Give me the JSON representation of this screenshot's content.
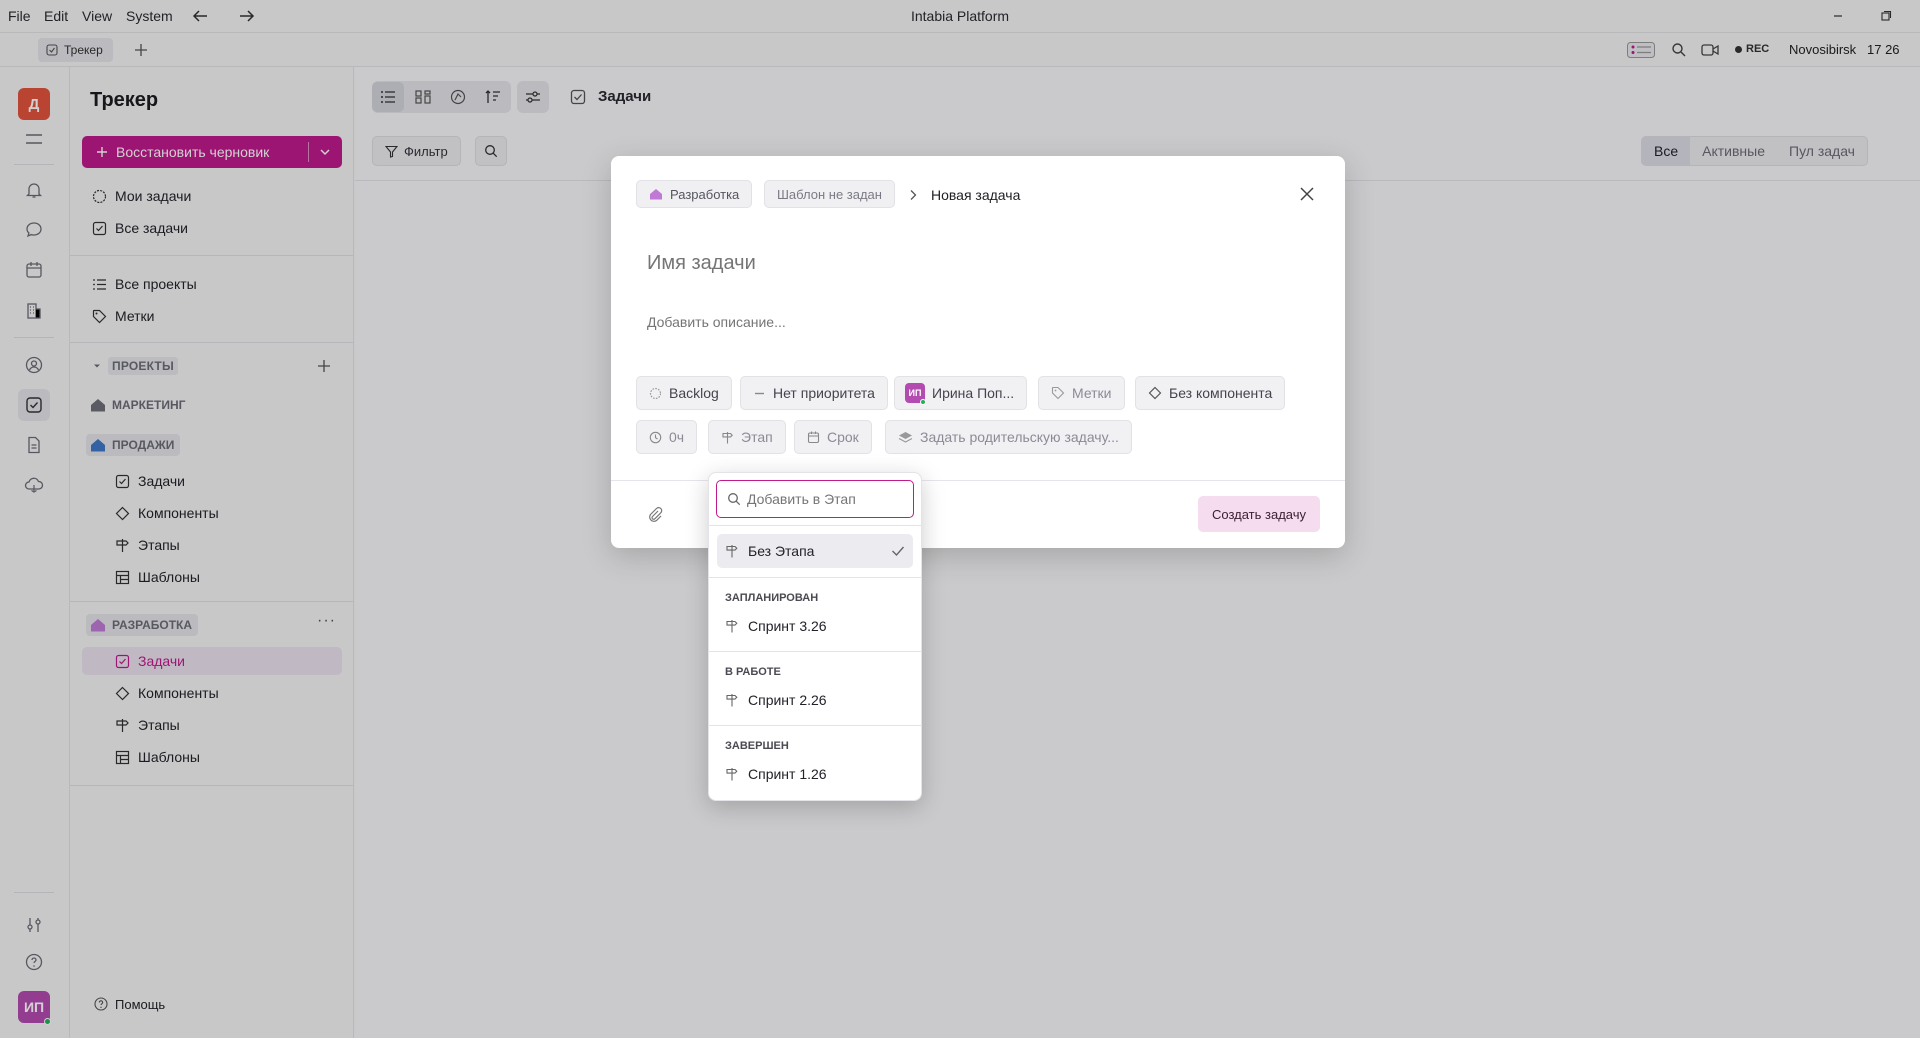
{
  "window": {
    "menu": [
      "File",
      "Edit",
      "View",
      "System"
    ],
    "title": "Intabia Platform"
  },
  "tabs": {
    "active": "Трекер"
  },
  "statusbar": {
    "rec": "REC",
    "location": "Novosibirsk",
    "time": "17 26"
  },
  "rail": {
    "workspace_initial": "Д",
    "user_initials": "ИП"
  },
  "sidebar": {
    "title": "Трекер",
    "restore_draft": "Восстановить черновик",
    "my_tasks": "Мои задачи",
    "all_tasks": "Все задачи",
    "all_projects": "Все проекты",
    "labels": "Метки",
    "projects_header": "ПРОЕКТЫ",
    "projects": [
      {
        "name": "МАРКЕТИНГ"
      },
      {
        "name": "ПРОДАЖИ",
        "items": [
          "Задачи",
          "Компоненты",
          "Этапы",
          "Шаблоны"
        ]
      },
      {
        "name": "РАЗРАБОТКА",
        "items": [
          "Задачи",
          "Компоненты",
          "Этапы",
          "Шаблоны"
        ]
      }
    ],
    "help": "Помощь"
  },
  "main": {
    "header_title": "Задачи",
    "filter": "Фильтр",
    "segments": [
      "Все",
      "Активные",
      "Пул задач"
    ],
    "active_segment": "Все"
  },
  "dialog": {
    "project": "Разработка",
    "template": "Шаблон не задан",
    "crumb_current": "Новая задача",
    "name_placeholder": "Имя задачи",
    "description_placeholder": "Добавить описание...",
    "status": "Backlog",
    "priority": "Нет приоритета",
    "assignee": "Ирина Поп...",
    "assignee_initials": "ИП",
    "labels": "Метки",
    "component": "Без компонента",
    "estimate": "0ч",
    "milestone": "Этап",
    "due_date": "Срок",
    "parent": "Задать родительскую задачу...",
    "create": "Создать задачу"
  },
  "popup": {
    "search_placeholder": "Добавить в Этап",
    "no_milestone": "Без Этапа",
    "groups": [
      {
        "header": "ЗАПЛАНИРОВАН",
        "item": "Спринт 3.26"
      },
      {
        "header": "В РАБОТЕ",
        "item": "Спринт 2.26"
      },
      {
        "header": "ЗАВЕРШЕН",
        "item": "Спринт 1.26"
      }
    ]
  },
  "colors": {
    "accent": "#c01a8d",
    "workspace_avatar": "#e2533d",
    "user_avatar": "#b44bb0",
    "project_marketing": "#6e6e78",
    "project_sales": "#3f78c8",
    "project_dev": "#c07ad6"
  }
}
